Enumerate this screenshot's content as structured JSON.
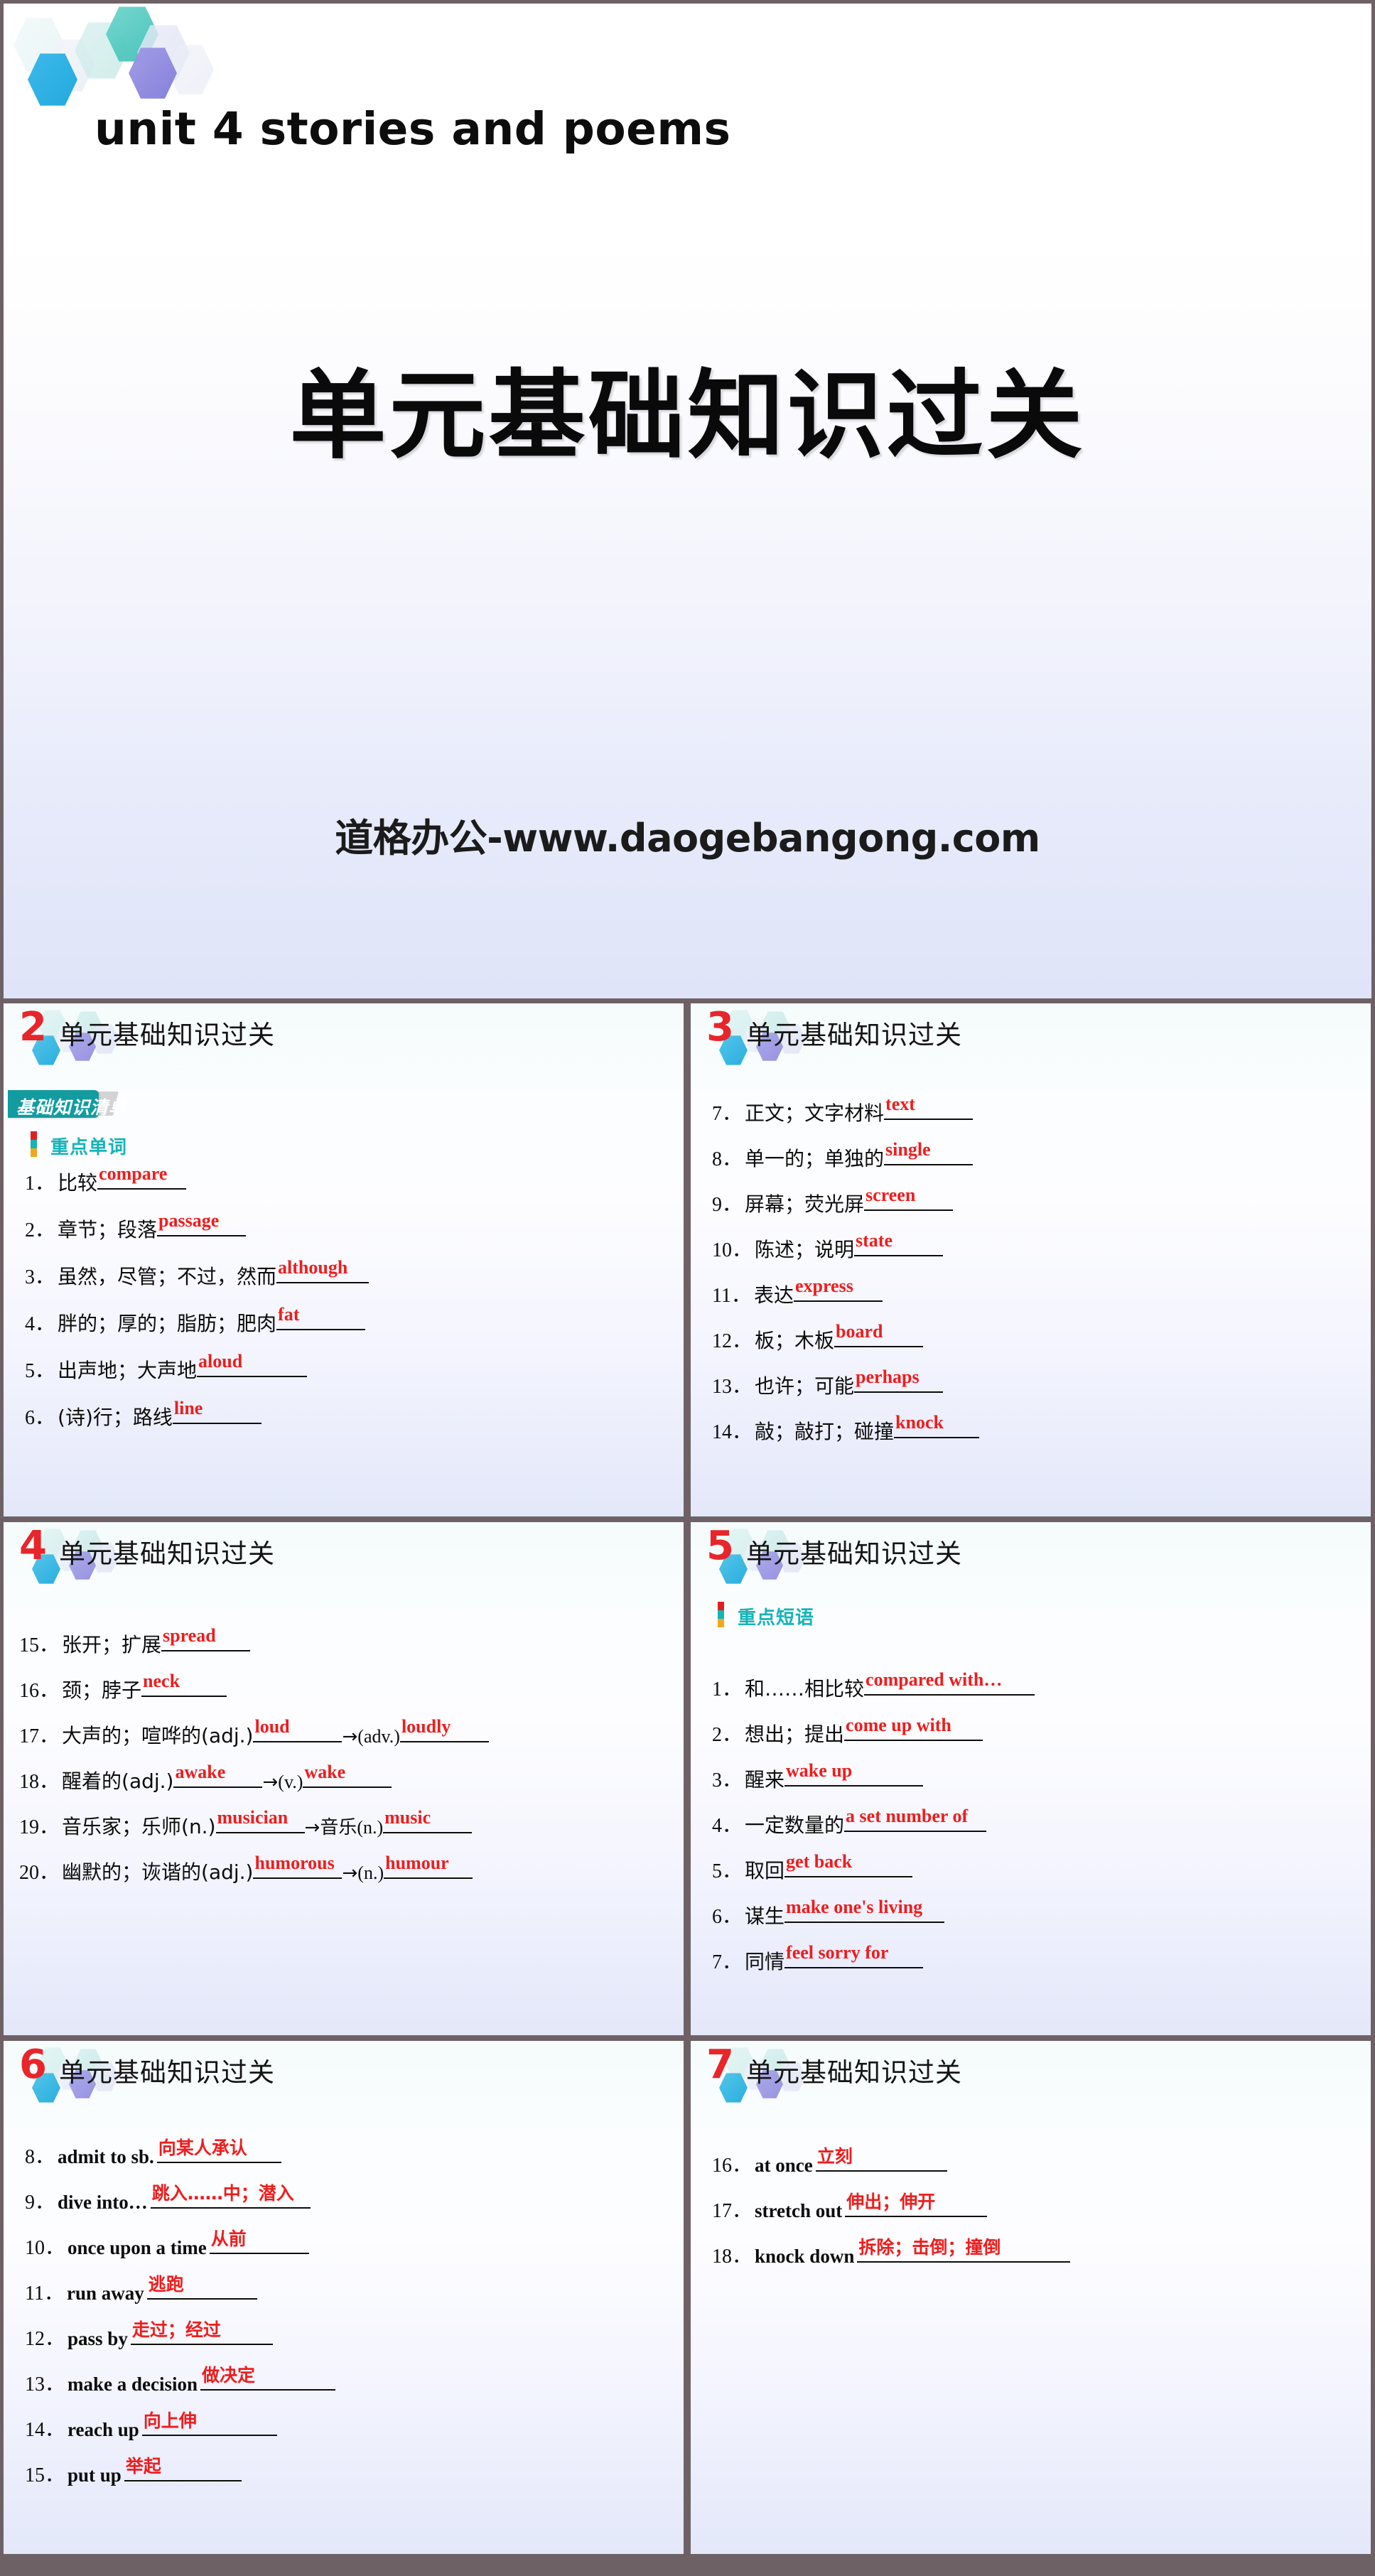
{
  "title_slide": {
    "english_title": "unit 4  stories and poems",
    "chinese_title": "单元基础知识过关",
    "watermark": "道格办公-www.daogebangong.com",
    "decoration_icon": "hexagon-cluster-icon"
  },
  "panel_title": "单元基础知识过关",
  "badge": {
    "text": "基础知识清单"
  },
  "sections": {
    "words": "重点单词",
    "phrases": "重点短语"
  },
  "panels": [
    {
      "number": "2",
      "title": "单元基础知识过关",
      "has_badge": true,
      "section": "重点单词",
      "items": [
        {
          "num": "1．",
          "cn": "比较",
          "ans": "compare",
          "blank": 125
        },
        {
          "num": "2．",
          "cn": "章节；段落",
          "ans": "passage",
          "blank": 125
        },
        {
          "num": "3．",
          "cn": "虽然，尽管；不过，然而",
          "ans": "although",
          "blank": 130
        },
        {
          "num": "4．",
          "cn": "胖的；厚的；脂肪；肥肉",
          "ans": "fat",
          "blank": 125
        },
        {
          "num": "5．",
          "cn": "出声地；大声地",
          "ans": "aloud",
          "blank": 155
        },
        {
          "num": "6．",
          "cn": "(诗)行；路线",
          "ans": "line",
          "blank": 125
        }
      ]
    },
    {
      "number": "3",
      "title": "单元基础知识过关",
      "has_badge": false,
      "items": [
        {
          "num": "7．",
          "cn": "正文；文字材料",
          "ans": "text",
          "blank": 125
        },
        {
          "num": "8．",
          "cn": "单一的；单独的",
          "ans": "single",
          "blank": 125
        },
        {
          "num": "9．",
          "cn": "屏幕；荧光屏",
          "ans": "screen",
          "blank": 125
        },
        {
          "num": "10．",
          "cn": "陈述；说明",
          "ans": "state",
          "blank": 125
        },
        {
          "num": "11．",
          "cn": "表达",
          "ans": "express",
          "blank": 125
        },
        {
          "num": "12．",
          "cn": "板；木板",
          "ans": "board",
          "blank": 125
        },
        {
          "num": "13．",
          "cn": "也许；可能",
          "ans": "perhaps",
          "blank": 125
        },
        {
          "num": "14．",
          "cn": "敲；敲打；碰撞",
          "ans": "knock",
          "blank": 120
        }
      ]
    },
    {
      "number": "4",
      "title": "单元基础知识过关",
      "has_badge": false,
      "items": [
        {
          "num": "15．",
          "cn": "张开；扩展",
          "ans": "spread",
          "blank": 125
        },
        {
          "num": "16．",
          "cn": "颈；脖子",
          "ans": "neck",
          "blank": 120
        },
        {
          "num": "17．",
          "cn": "大声的；喧哗的(adj.)",
          "ans": "loud",
          "blank": 125,
          "arrow": "→",
          "pos2": "(adv.)",
          "ans2": "loudly",
          "blank2": 125
        },
        {
          "num": "18．",
          "cn": "醒着的(adj.)",
          "ans": "awake",
          "blank": 125,
          "arrow": "→",
          "pos2": "(v.)",
          "ans2": "wake",
          "blank2": 125
        },
        {
          "num": "19．",
          "cn": "音乐家；乐师(n.)",
          "ans": "musician",
          "blank": 125,
          "arrow": "→",
          "pos2": "音乐(n.)",
          "ans2": "music",
          "blank2": 125
        },
        {
          "num": "20．",
          "cn": "幽默的；诙谐的(adj.)",
          "ans": "humorous",
          "blank": 125,
          "arrow": "→",
          "pos2": "(n.)",
          "ans2": "humour",
          "blank2": 125
        }
      ]
    },
    {
      "number": "5",
      "title": "单元基础知识过关",
      "has_badge": false,
      "section": "重点短语",
      "items": [
        {
          "num": "1．",
          "cn": "和……相比较",
          "ans": "compared with…",
          "blank": 240
        },
        {
          "num": "2．",
          "cn": "想出；提出",
          "ans": "come up with",
          "blank": 195
        },
        {
          "num": "3．",
          "cn": "醒来",
          "ans": "wake up",
          "blank": 195
        },
        {
          "num": "4．",
          "cn": "一定数量的",
          "ans": "a set number of",
          "blank": 200
        },
        {
          "num": "5．",
          "cn": "取回",
          "ans": "get back",
          "blank": 180
        },
        {
          "num": "6．",
          "cn": "谋生",
          "ans": "make one's living",
          "blank": 225
        },
        {
          "num": "7．",
          "cn": "同情",
          "ans": "feel sorry for",
          "blank": 195
        }
      ]
    },
    {
      "number": "6",
      "title": "单元基础知识过关",
      "has_badge": false,
      "items": [
        {
          "num": "8．",
          "en": "admit to sb.",
          "ans": "向某人承认",
          "blank": 175
        },
        {
          "num": "9．",
          "en": "dive into…",
          "ans": "跳入……中；潜入",
          "blank": 225
        },
        {
          "num": "10．",
          "en": "once upon a time",
          "ans": "从前",
          "blank": 140
        },
        {
          "num": "11．",
          "en": "run away",
          "ans": "逃跑",
          "blank": 155
        },
        {
          "num": "12．",
          "en": "pass by",
          "ans": "走过；经过",
          "blank": 200
        },
        {
          "num": "13．",
          "en": "make a decision",
          "ans": "做决定",
          "blank": 190
        },
        {
          "num": "14．",
          "en": "reach up",
          "ans": "向上伸",
          "blank": 190
        },
        {
          "num": "15．",
          "en": "put up",
          "ans": "举起",
          "blank": 165
        }
      ]
    },
    {
      "number": "7",
      "title": "单元基础知识过关",
      "has_badge": false,
      "items": [
        {
          "num": "16．",
          "en": "at once",
          "ans": "立刻",
          "blank": 185
        },
        {
          "num": "17．",
          "en": "stretch out",
          "ans": "伸出；伸开",
          "blank": 200
        },
        {
          "num": "18．",
          "en": "knock down",
          "ans": "拆除；击倒；撞倒",
          "blank": 300
        }
      ]
    }
  ],
  "colors": {
    "answer_red": "#ee1d1d",
    "panel_number_red": "#e8252a",
    "section_teal": "#16b3b8",
    "badge_teal": "#139ca0",
    "frame": "#6e6166"
  }
}
